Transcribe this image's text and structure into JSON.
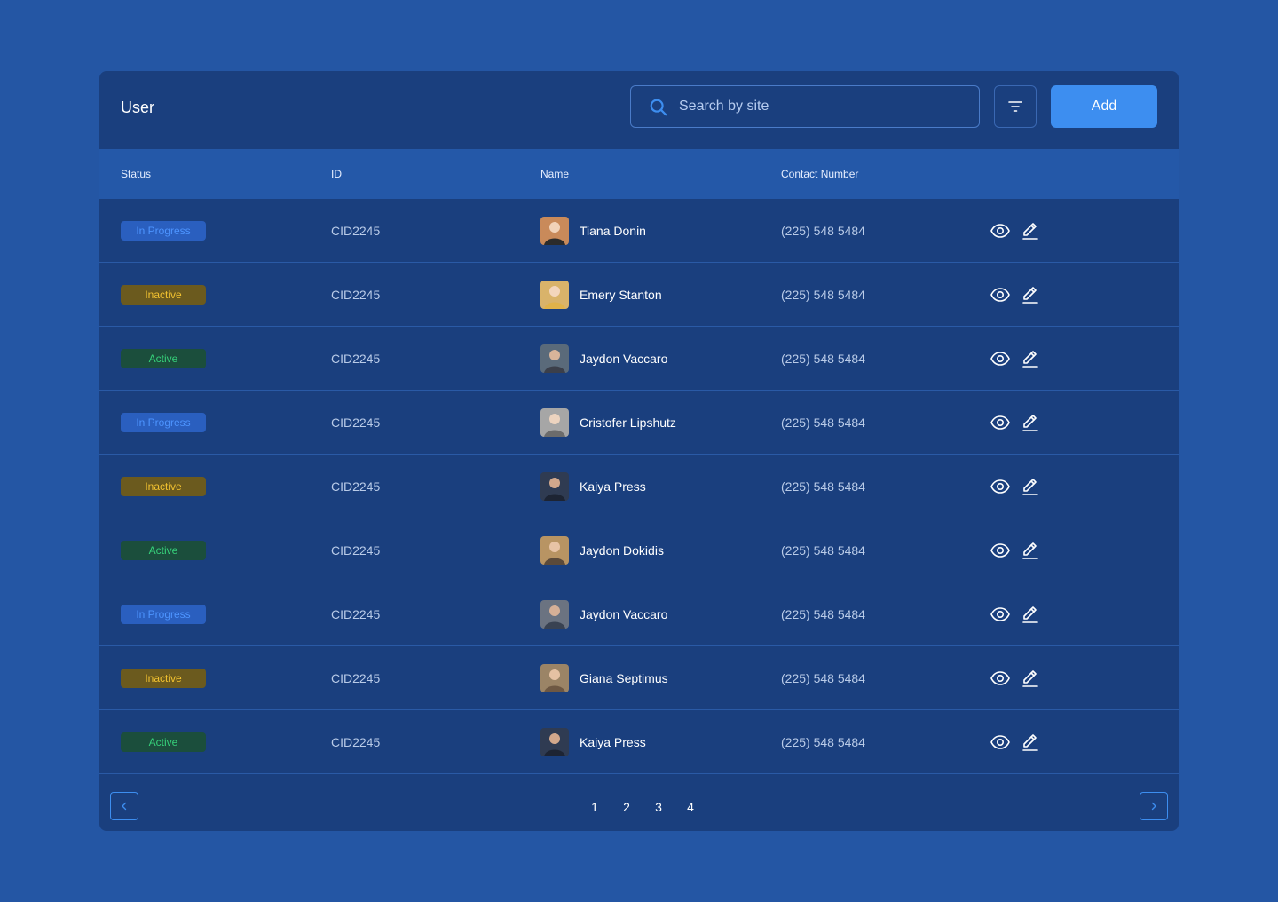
{
  "header": {
    "title": "User",
    "search_placeholder": "Search by site",
    "add_label": "Add"
  },
  "columns": [
    "Status",
    "ID",
    "Name",
    "Contact Number"
  ],
  "rows": [
    {
      "status": "In Progress",
      "status_type": "progress",
      "id": "CID2245",
      "name": "Tiana Donin",
      "phone": "(225) 548 5484"
    },
    {
      "status": "Inactive",
      "status_type": "inactive",
      "id": "CID2245",
      "name": "Emery Stanton",
      "phone": "(225) 548 5484"
    },
    {
      "status": "Active",
      "status_type": "active",
      "id": "CID2245",
      "name": "Jaydon Vaccaro",
      "phone": "(225) 548 5484"
    },
    {
      "status": "In Progress",
      "status_type": "progress",
      "id": "CID2245",
      "name": "Cristofer Lipshutz",
      "phone": "(225) 548 5484"
    },
    {
      "status": "Inactive",
      "status_type": "inactive",
      "id": "CID2245",
      "name": "Kaiya Press",
      "phone": "(225) 548 5484"
    },
    {
      "status": "Active",
      "status_type": "active",
      "id": "CID2245",
      "name": "Jaydon Dokidis",
      "phone": "(225) 548 5484"
    },
    {
      "status": "In Progress",
      "status_type": "progress",
      "id": "CID2245",
      "name": "Jaydon Vaccaro",
      "phone": "(225) 548 5484"
    },
    {
      "status": "Inactive",
      "status_type": "inactive",
      "id": "CID2245",
      "name": "Giana Septimus",
      "phone": "(225) 548 5484"
    },
    {
      "status": "Active",
      "status_type": "active",
      "id": "CID2245",
      "name": "Kaiya Press",
      "phone": "(225) 548 5484"
    }
  ],
  "pagination": {
    "pages": [
      "1",
      "2",
      "3",
      "4"
    ]
  },
  "icons": {
    "search": "search-icon",
    "filter": "filter-icon",
    "view": "eye-icon",
    "edit": "pencil-icon",
    "prev": "chevron-left-icon",
    "next": "chevron-right-icon"
  },
  "colors": {
    "page_bg": "#2456a4",
    "card_bg": "#1a3f7e",
    "table_header_bg": "#2458a8",
    "accent": "#3d8ef0",
    "in_progress": "#4d94ff",
    "inactive": "#f2c230",
    "active": "#36d07a"
  }
}
